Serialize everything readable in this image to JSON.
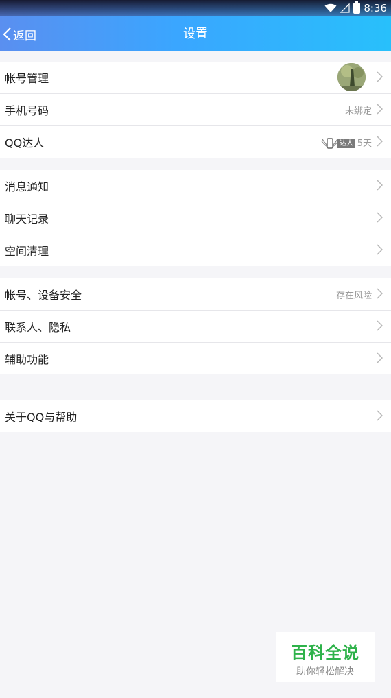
{
  "status": {
    "time": "8:36"
  },
  "header": {
    "back_label": "返回",
    "title": "设置"
  },
  "groups": [
    {
      "items": [
        {
          "label": "帐号管理"
        },
        {
          "label": "手机号码",
          "value": "未绑定"
        },
        {
          "label": "QQ达人",
          "badge": "达人",
          "value": "5天"
        }
      ]
    },
    {
      "items": [
        {
          "label": "消息通知"
        },
        {
          "label": "聊天记录"
        },
        {
          "label": "空间清理"
        }
      ]
    },
    {
      "items": [
        {
          "label": "帐号、设备安全",
          "value": "存在风险"
        },
        {
          "label": "联系人、隐私"
        },
        {
          "label": "辅助功能"
        }
      ]
    },
    {
      "items": [
        {
          "label": "关于QQ与帮助"
        }
      ]
    }
  ],
  "watermark": {
    "title": "百科全说",
    "subtitle": "助你轻松解决"
  }
}
